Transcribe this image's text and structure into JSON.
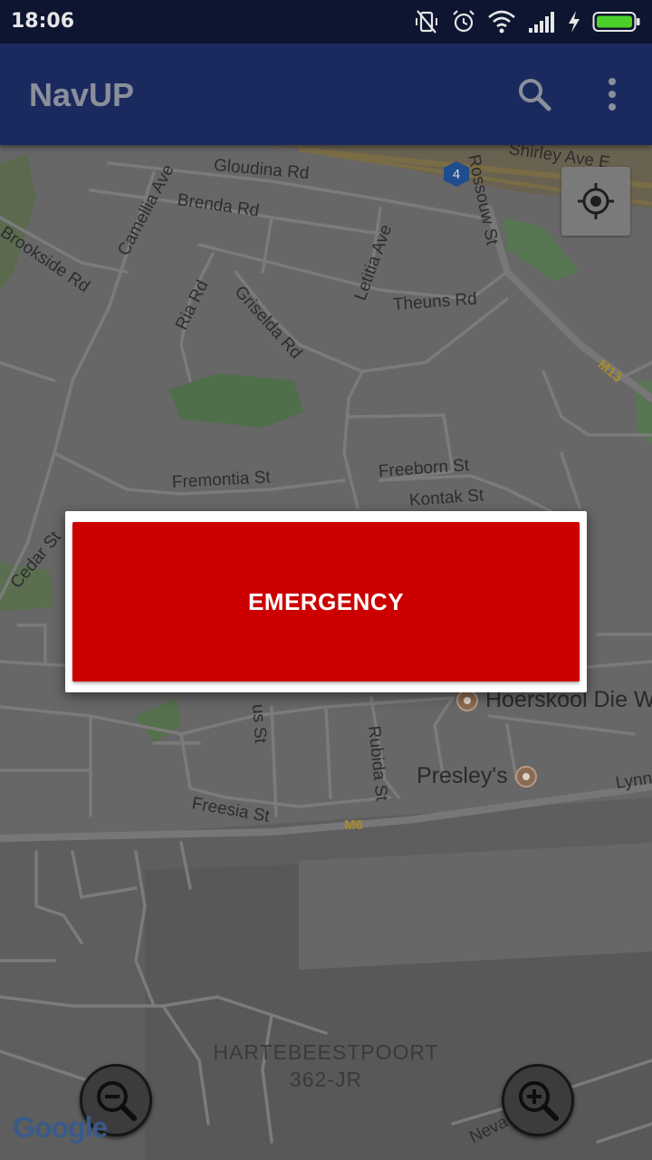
{
  "status_bar": {
    "time": "18:06",
    "icons": [
      "vibrate-off-icon",
      "alarm-icon",
      "wifi-icon",
      "signal-icon",
      "charging-icon",
      "battery-icon"
    ]
  },
  "app_bar": {
    "title": "NavUP",
    "actions": [
      "search-icon",
      "more-vert-icon"
    ]
  },
  "map": {
    "roads": [
      "Gloudina Rd",
      "Brenda Rd",
      "Camellia Ave",
      "Brookside Rd",
      "Letitia Ave",
      "Ria Rd",
      "Griselda Rd",
      "Theuns Rd",
      "Fremontia St",
      "Freeborn St",
      "Kontak St",
      "Cedar St",
      "Rubida St",
      "Freesia St",
      "Lynn",
      "Shirley Ave E",
      "Rossouw St",
      "us St",
      "Neva"
    ],
    "highways": [
      "M13",
      "M6"
    ],
    "route_shield": "4",
    "pois": [
      "Hoërskool Die W",
      "Presley's"
    ],
    "area": {
      "line1": "HARTEBEESTPOORT",
      "line2": "362-JR"
    },
    "attribution": "Google"
  },
  "controls": {
    "my_location": "my-location-icon",
    "zoom_out": "zoom-out-icon",
    "zoom_in": "zoom-in-icon"
  },
  "dialog": {
    "emergency_label": "EMERGENCY"
  },
  "colors": {
    "app_bar": "#1b2a5e",
    "status_bar": "#0d1530",
    "emergency": "#cc0000",
    "map_dimmed": "#676767",
    "park": "#4a7a44"
  }
}
